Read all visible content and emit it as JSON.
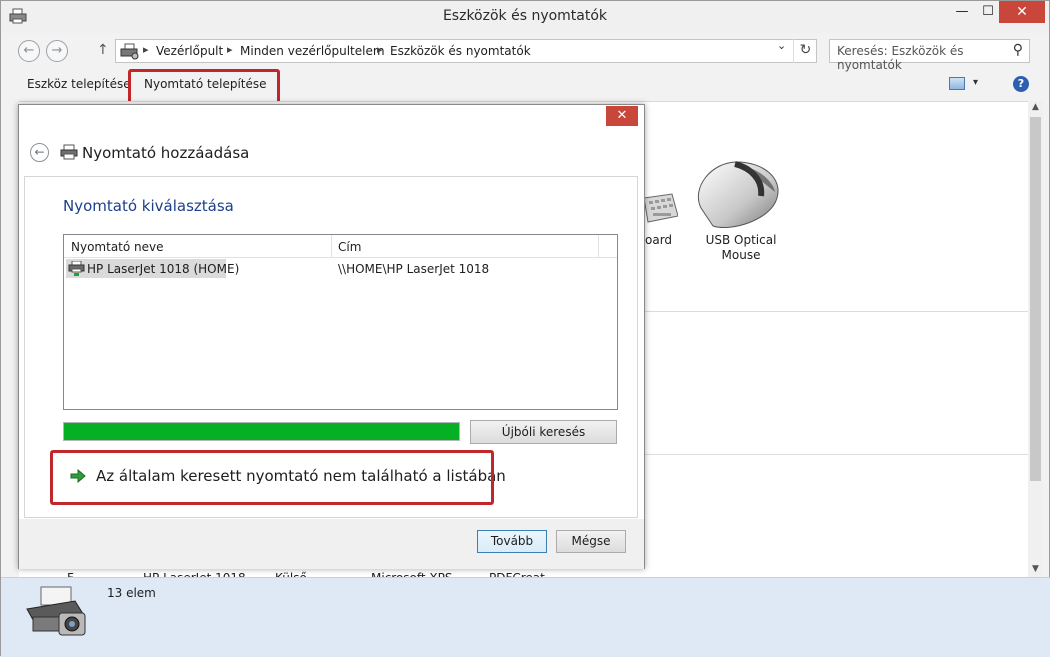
{
  "window": {
    "title": "Eszközök és nyomtatók",
    "minimize": "—",
    "maximize": "☐",
    "close": "✕"
  },
  "nav": {
    "back": "←",
    "forward": "→",
    "up": "↑",
    "breadcrumbs": [
      "Vezérlőpult",
      "Minden vezérlőpultelem",
      "Eszközök és nyomtatók"
    ],
    "separator": "▸",
    "dropdown": "⌄",
    "refresh": "↻",
    "search_placeholder": "Keresés: Eszközök és nyomtatók"
  },
  "toolbar": {
    "add_device": "Eszköz telepítése",
    "add_printer": "Nyomtató telepítése",
    "view_dropdown": "▾",
    "help": "?"
  },
  "devices": {
    "keyboard_label_partial": "oard",
    "mouse_label": "USB Optical Mouse"
  },
  "partial_labels": [
    "F",
    "HP LaserJet 1018",
    "Külső",
    "Microsoft XPS",
    "PDFCreat"
  ],
  "status": {
    "count": "13 elem"
  },
  "dialog": {
    "close": "✕",
    "back": "←",
    "title": "Nyomtató hozzáadása",
    "subtitle": "Nyomtató kiválasztása",
    "columns": [
      "Nyomtató neve",
      "Cím"
    ],
    "rows": [
      {
        "name": "HP LaserJet 1018 (HOME)",
        "address": "\\\\HOME\\HP LaserJet 1018"
      }
    ],
    "progress": 1.0,
    "research_button": "Újbóli keresés",
    "not_found_link": "Az általam keresett nyomtató nem található a listában",
    "next_button": "Tovább",
    "cancel_button": "Mégse"
  },
  "colors": {
    "highlight": "#c0262a",
    "progress": "#06b025",
    "subtitle": "#1e3f8a",
    "close_button": "#c9463a"
  }
}
